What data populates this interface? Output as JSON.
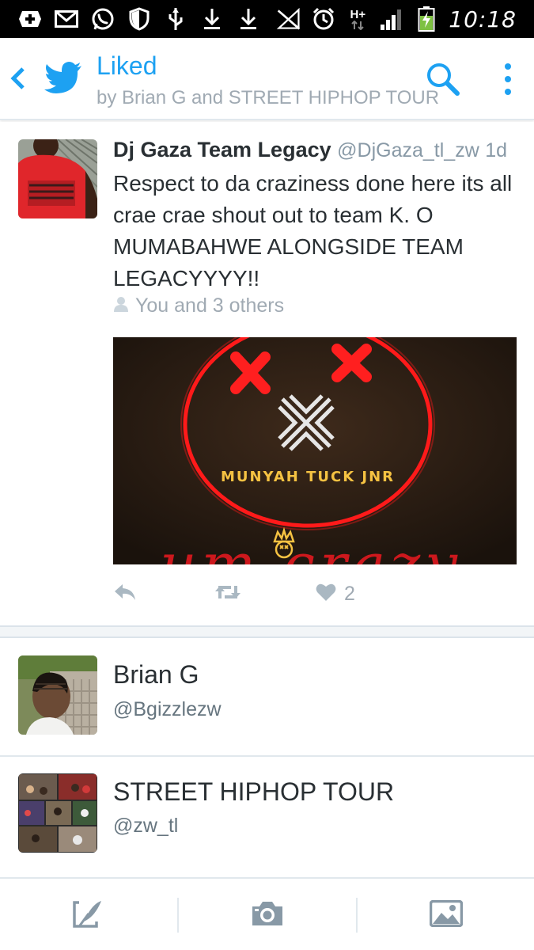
{
  "status_bar": {
    "time": "10:18",
    "network": "H+",
    "left_icons": [
      "plus-box-icon",
      "mail-icon",
      "whatsapp-icon",
      "shield-icon",
      "usb-icon",
      "download-icon",
      "download-icon"
    ],
    "right_icons": [
      "no-signal-icon",
      "alarm-icon",
      "network-type-icon",
      "signal-bars-icon",
      "battery-charging-icon"
    ]
  },
  "header": {
    "title": "Liked",
    "subtitle": "by Brian G and STREET HIPHOP TOUR",
    "accent_color": "#1da1f2"
  },
  "tweet": {
    "author_name": "Dj Gaza Team Legacy",
    "author_handle": "@DjGaza_tl_zw",
    "age": "1d",
    "text": "Respect to da craziness done here its all crae crae shout out to team K. O MUMABAHWE ALONGSIDE TEAM LEGACYYYY!!",
    "liked_by": "You and 3 others",
    "media": {
      "caption": "MUNYAH TUCK JNR",
      "bottom_text": "um crazy"
    },
    "like_count": "2"
  },
  "users": [
    {
      "name": "Brian G",
      "handle": "@Bgizzlezw"
    },
    {
      "name": "STREET HIPHOP TOUR",
      "handle": "@zw_tl"
    }
  ],
  "bottom_bar": {
    "buttons": [
      "compose-icon",
      "camera-icon",
      "gallery-icon"
    ]
  }
}
